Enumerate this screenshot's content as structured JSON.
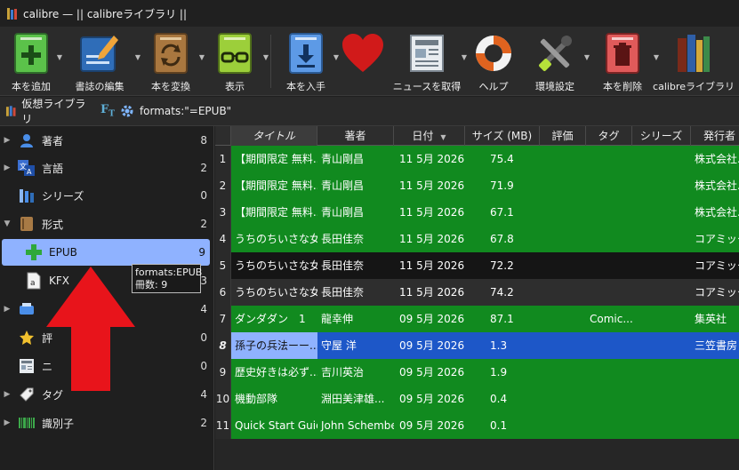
{
  "window": {
    "title": "calibre — || calibreライブラリ ||"
  },
  "colors": {
    "green_row": "#118a1f",
    "selected_row": "#1d57c8",
    "selected_cell": "#8fb2ff",
    "dark_row": "#151515",
    "sidebar_selected": "#8fb2ff",
    "arrow": "#e8141b"
  },
  "toolbar": [
    {
      "label": "本を追加",
      "icon": "add-book-icon"
    },
    {
      "label": "書誌の編集",
      "icon": "edit-metadata-icon"
    },
    {
      "label": "本を変換",
      "icon": "convert-book-icon"
    },
    {
      "label": "表示",
      "icon": "view-book-icon"
    },
    {
      "label": "本を入手",
      "icon": "get-books-icon"
    },
    {
      "label": "",
      "icon": "heart-icon"
    },
    {
      "label": "ニュースを取得",
      "icon": "fetch-news-icon"
    },
    {
      "label": "ヘルプ",
      "icon": "help-lifebuoy-icon"
    },
    {
      "label": "環境設定",
      "icon": "preferences-icon"
    },
    {
      "label": "本を削除",
      "icon": "remove-book-icon"
    },
    {
      "label": "calibreライブラリ",
      "icon": "library-icon"
    }
  ],
  "searchbar": {
    "virtual_library": "仮想ライブラリ",
    "ft_label": "F",
    "ft_sub": "T",
    "query": "formats:\"=EPUB\""
  },
  "sidebar": [
    {
      "label": "著者",
      "count": "8",
      "icon": "authors-icon",
      "expand": "▶"
    },
    {
      "label": "言語",
      "count": "2",
      "icon": "languages-icon",
      "expand": "▶"
    },
    {
      "label": "シリーズ",
      "count": "0",
      "icon": "series-icon",
      "expand": ""
    },
    {
      "label": "形式",
      "count": "2",
      "icon": "formats-icon",
      "expand": "▼"
    },
    {
      "label": "EPUB",
      "count": "9",
      "icon": "epub-plus-icon",
      "expand": "",
      "selected": true
    },
    {
      "label": "KFX",
      "count": "3",
      "icon": "kfx-icon",
      "expand": ""
    },
    {
      "label": "",
      "count": "4",
      "icon": "publisher-icon",
      "expand": "▶"
    },
    {
      "label": "評",
      "count": "0",
      "icon": "rating-star-icon",
      "expand": ""
    },
    {
      "label": "ニ",
      "count": "0",
      "icon": "news-icon",
      "expand": ""
    },
    {
      "label": "タグ",
      "count": "4",
      "icon": "tags-icon",
      "expand": "▶"
    },
    {
      "label": "識別子",
      "count": "2",
      "icon": "identifiers-icon",
      "expand": "▶"
    }
  ],
  "tooltip": {
    "line1": "formats:EPUB",
    "line2": "冊数: 9"
  },
  "table": {
    "columns": [
      "タイトル",
      "著者",
      "日付",
      "サイズ (MB)",
      "評価",
      "タグ",
      "シリーズ",
      "発行者"
    ],
    "rows": [
      {
        "n": "1",
        "title": "【期間限定 無料...",
        "author": "青山剛昌",
        "date": "11 5月 2026",
        "size": "75.4",
        "rating": "",
        "tags": "",
        "series": "",
        "publisher": "株式会社...",
        "style": "green"
      },
      {
        "n": "2",
        "title": "【期間限定 無料...",
        "author": "青山剛昌",
        "date": "11 5月 2026",
        "size": "71.9",
        "rating": "",
        "tags": "",
        "series": "",
        "publisher": "株式会社...",
        "style": "green"
      },
      {
        "n": "3",
        "title": "【期間限定 無料...",
        "author": "青山剛昌",
        "date": "11 5月 2026",
        "size": "67.1",
        "rating": "",
        "tags": "",
        "series": "",
        "publisher": "株式会社...",
        "style": "green"
      },
      {
        "n": "4",
        "title": "うちのちいさな女...",
        "author": "長田佳奈",
        "date": "11 5月 2026",
        "size": "67.8",
        "rating": "",
        "tags": "",
        "series": "",
        "publisher": "コアミックス",
        "style": "green"
      },
      {
        "n": "5",
        "title": "うちのちいさな女...",
        "author": "長田佳奈",
        "date": "11 5月 2026",
        "size": "72.2",
        "rating": "",
        "tags": "",
        "series": "",
        "publisher": "コアミックス",
        "style": "dark"
      },
      {
        "n": "6",
        "title": "うちのちいさな女...",
        "author": "長田佳奈",
        "date": "11 5月 2026",
        "size": "74.2",
        "rating": "",
        "tags": "",
        "series": "",
        "publisher": "コアミックス",
        "style": "gray"
      },
      {
        "n": "7",
        "title": "ダンダダン　1",
        "author": "龍幸伸",
        "date": "09 5月 2026",
        "size": "87.1",
        "rating": "",
        "tags": "Comic...",
        "series": "",
        "publisher": "集英社",
        "style": "green"
      },
      {
        "n": "8",
        "title": "孫子の兵法ーー...",
        "author": "守屋 洋",
        "date": "09 5月 2026",
        "size": "1.3",
        "rating": "",
        "tags": "",
        "series": "",
        "publisher": "三笠書房",
        "style": "selected"
      },
      {
        "n": "9",
        "title": "歴史好きは必ず...",
        "author": "吉川英治",
        "date": "09 5月 2026",
        "size": "1.9",
        "rating": "",
        "tags": "",
        "series": "",
        "publisher": "",
        "style": "green"
      },
      {
        "n": "10",
        "title": "機動部隊",
        "author": "淵田美津雄...",
        "date": "09 5月 2026",
        "size": "0.4",
        "rating": "",
        "tags": "",
        "series": "",
        "publisher": "",
        "style": "green"
      },
      {
        "n": "11",
        "title": "Quick Start Guide",
        "author": "John Schember",
        "date": "09 5月 2026",
        "size": "0.1",
        "rating": "",
        "tags": "",
        "series": "",
        "publisher": "",
        "style": "green"
      }
    ]
  }
}
